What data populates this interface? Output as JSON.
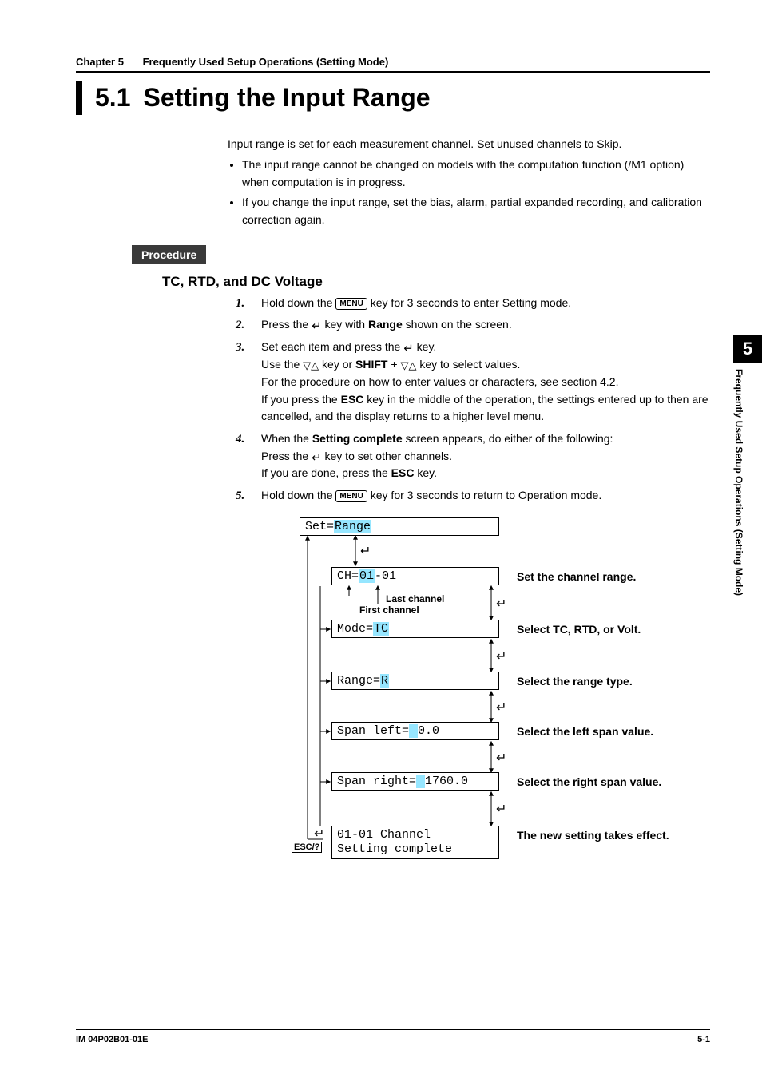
{
  "running_head": {
    "chapter": "Chapter 5",
    "title": "Frequently Used Setup Operations (Setting Mode)"
  },
  "section": {
    "number": "5.1",
    "title": "Setting the Input Range"
  },
  "intro": {
    "lead": "Input range is set for each measurement channel. Set unused channels to Skip.",
    "b1": "The input range cannot be changed on models with the computation function (/M1 option) when computation is in progress.",
    "b2": "If you change the input range, set the bias, alarm, partial expanded recording, and calibration correction again."
  },
  "procedure_label": "Procedure",
  "subheading": "TC, RTD, and DC Voltage",
  "keys": {
    "menu": "MENU",
    "esc": "ESC",
    "shift": "SHIFT",
    "range": "Range",
    "setting_complete": "Setting complete",
    "escq": "ESC/?"
  },
  "steps": {
    "s1a": "Hold down the ",
    "s1b": " key for 3 seconds to enter Setting mode.",
    "s2a": "Press the ",
    "s2b": " key with ",
    "s2c": " shown on the screen.",
    "s3a": "Set each item and press the ",
    "s3b": " key.",
    "s3c": "Use the ",
    "s3d": " key or ",
    "s3e": " + ",
    "s3f": " key to select values.",
    "s3g": "For the procedure on how to enter values or characters, see section 4.2.",
    "s3h": "If you press the ",
    "s3i": " key in the middle of the operation, the settings entered up to then are cancelled, and the display returns to a higher level menu.",
    "s4a": "When the ",
    "s4b": " screen appears, do either of the following:",
    "s4c": "Press the ",
    "s4d": " key to set other channels.",
    "s4e": "If you are done, press the ",
    "s4f": " key.",
    "s5a": "Hold down the ",
    "s5b": " key for 3 seconds to return to Operation mode."
  },
  "diagram": {
    "box1_pre": "Set=",
    "box1_hl": "Range",
    "box2_pre": "CH=",
    "box2_hl": "01",
    "box2_suf": "-01",
    "box3_pre": "Mode=",
    "box3_hl": "TC",
    "box4_pre": "Range=",
    "box4_hl": "R",
    "box5_pre": "Span left=",
    "box5_hl": " ",
    "box5_suf": "  0.0",
    "box6_pre": "Span right=",
    "box6_hl": " ",
    "box6_suf": "1760.0",
    "box7a": "01-01 Channel",
    "box7b": "Setting complete",
    "label_last": "Last channel",
    "label_first": "First channel",
    "a2": "Set the channel range.",
    "a3": "Select TC, RTD, or Volt.",
    "a4": "Select the range type.",
    "a5": "Select the left span value.",
    "a6": "Select the right span value.",
    "a7": "The new setting takes effect."
  },
  "side": {
    "num": "5",
    "text": "Frequently Used Setup Operations (Setting Mode)"
  },
  "footer": {
    "left": "IM 04P02B01-01E",
    "right": "5-1"
  }
}
